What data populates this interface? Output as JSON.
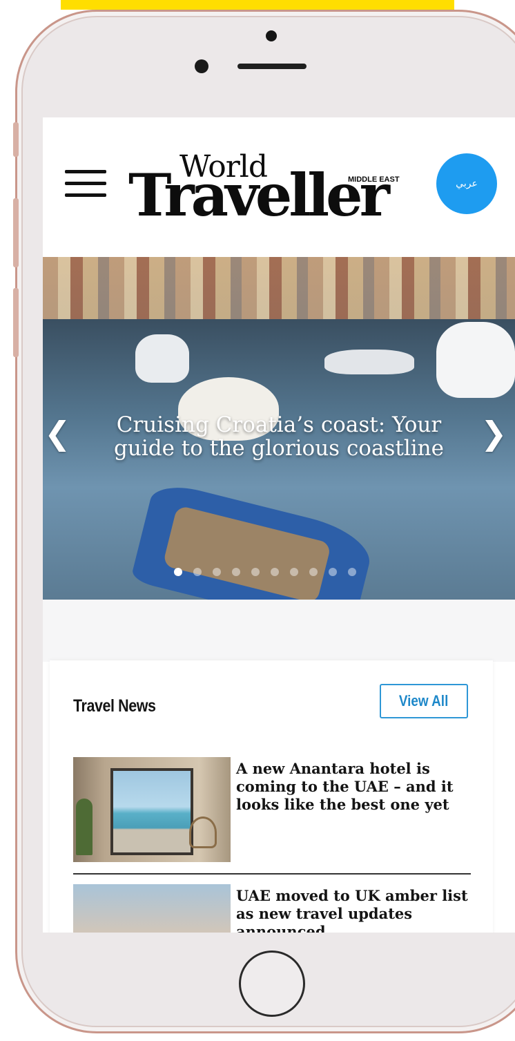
{
  "site": {
    "logo_line1": "World",
    "logo_line2": "Traveller",
    "logo_region": "MIDDLE EAST",
    "language_button": "عربي",
    "brand_color": "#1e9cf0"
  },
  "hero": {
    "title": "Cruising Croatia’s coast: Your guide to the glorious coastline",
    "prev_icon": "chevron-left-icon",
    "next_icon": "chevron-right-icon",
    "slide_count": 10,
    "active_slide": 1
  },
  "travel_news": {
    "section_title": "Travel News",
    "view_all_label": "View All",
    "accent_color": "#2e97d6",
    "items": [
      {
        "headline": "A new Anantara hotel is coming to the UAE – and it looks like the best one yet"
      },
      {
        "headline": "UAE moved to UK amber list as new travel updates announced"
      }
    ]
  },
  "device": {
    "home_button_icon": "home-button-icon"
  }
}
